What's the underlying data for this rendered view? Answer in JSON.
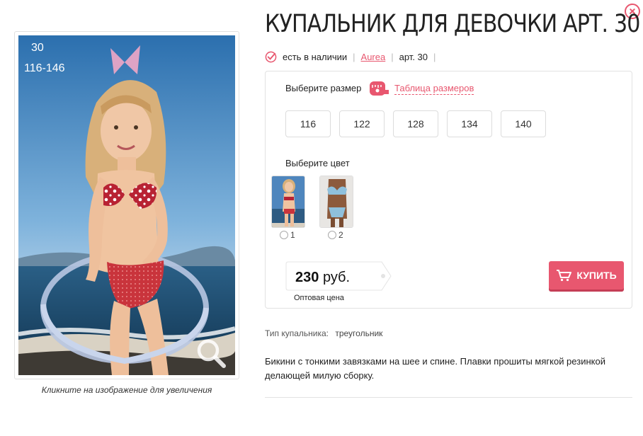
{
  "product": {
    "title": "КУПАЛЬНИК ДЛЯ ДЕВОЧКИ АРТ. 30",
    "availability": "есть в наличии",
    "brand": "Aurea",
    "article": "арт. 30"
  },
  "image": {
    "article_overlay": "30",
    "size_range_overlay": "116-146",
    "caption": "Кликните на изображение для увеличения"
  },
  "options": {
    "size_label": "Выберите размер",
    "size_table_link": "Таблица размеров",
    "sizes": [
      "116",
      "122",
      "128",
      "134",
      "140"
    ],
    "color_label": "Выберите цвет",
    "colors": [
      {
        "label": "1"
      },
      {
        "label": "2"
      }
    ]
  },
  "price": {
    "amount": "230",
    "currency": "руб.",
    "caption": "Оптовая цена"
  },
  "buy_button": {
    "label": "КУПИТЬ"
  },
  "specs": {
    "type_key": "Тип купальника:",
    "type_value": "треугольник"
  },
  "description": "Бикини с тонкими завязками на шее и спине. Плавки прошиты мягкой резинкой делающей милую сборку.",
  "colors": {
    "accent": "#e8576f",
    "text": "#222222",
    "border": "#e2e2e2"
  },
  "icons": {
    "close": "close-icon",
    "availability": "check-circle-icon",
    "size_table": "measuring-tape-icon",
    "zoom": "magnifier-icon",
    "cart": "cart-icon"
  }
}
